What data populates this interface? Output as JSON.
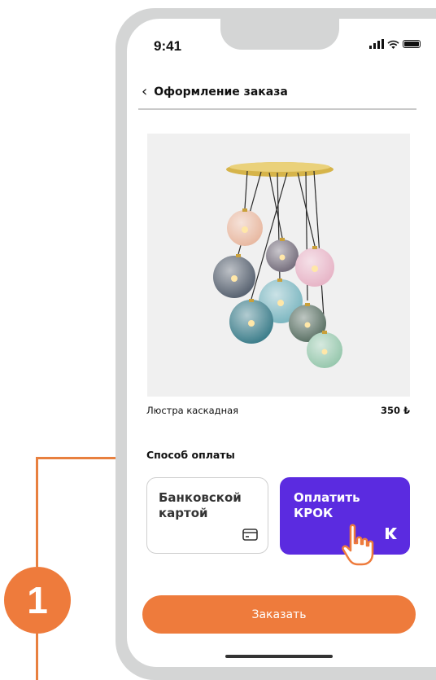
{
  "annotation": {
    "step_number": "1",
    "color": "#ee7b3c"
  },
  "status_bar": {
    "time": "9:41"
  },
  "nav": {
    "back_icon": "chevron-left-icon",
    "title": "Оформление заказа"
  },
  "product": {
    "image": "cascade-chandelier-image",
    "name": "Люстра каскадная",
    "price": "350 ₺"
  },
  "payment": {
    "title": "Способ оплаты",
    "options": [
      {
        "label": "Банковской картой",
        "icon": "credit-card-icon",
        "selected": false
      },
      {
        "label": "Оплатить КРОК",
        "icon": "krok-logo-icon",
        "selected": true,
        "color": "#5b2be0"
      }
    ]
  },
  "order_button": {
    "label": "Заказать",
    "color": "#ee7b3c"
  }
}
